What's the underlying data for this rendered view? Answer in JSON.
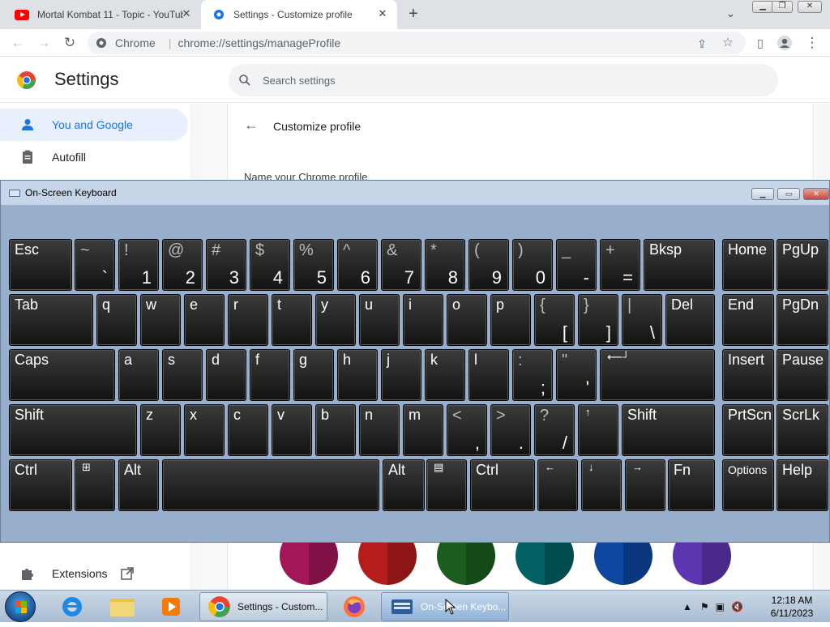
{
  "browser": {
    "tabs": [
      {
        "label": "Mortal Kombat 11 - Topic - YouTube",
        "icon": "youtube-icon"
      },
      {
        "label": "Settings - Customize profile",
        "icon": "settings-gear-icon",
        "active": true
      }
    ],
    "omnibox": {
      "site_chip": "Chrome",
      "url": "chrome://settings/manageProfile"
    }
  },
  "settings": {
    "title": "Settings",
    "search_placeholder": "Search settings",
    "sidebar": [
      {
        "label": "You and Google",
        "icon": "person-icon",
        "active": true
      },
      {
        "label": "Autofill",
        "icon": "clipboard-icon"
      },
      {
        "label": "Extensions",
        "icon": "puzzle-icon"
      }
    ],
    "page_title": "Customize profile",
    "name_label": "Name your Chrome profile",
    "swatch_colors": [
      "#a3165a",
      "#b71c1c",
      "#1b5e20",
      "#006064",
      "#0d47a1",
      "#5e35b1"
    ]
  },
  "osk": {
    "title": "On-Screen Keyboard",
    "rows": [
      [
        {
          "top": "Esc"
        },
        {
          "sym": "~",
          "bot": "`"
        },
        {
          "sym": "!",
          "bot": "1"
        },
        {
          "sym": "@",
          "bot": "2"
        },
        {
          "sym": "#",
          "bot": "3"
        },
        {
          "sym": "$",
          "bot": "4"
        },
        {
          "sym": "%",
          "bot": "5"
        },
        {
          "sym": "^",
          "bot": "6"
        },
        {
          "sym": "&",
          "bot": "7"
        },
        {
          "sym": "*",
          "bot": "8"
        },
        {
          "sym": "(",
          "bot": "9"
        },
        {
          "sym": ")",
          "bot": "0"
        },
        {
          "sym": "_",
          "bot": "-"
        },
        {
          "sym": "+",
          "bot": "="
        },
        {
          "top": "Bksp"
        },
        {
          "top": "Home"
        },
        {
          "top": "PgUp"
        }
      ],
      [
        {
          "top": "Tab"
        },
        {
          "top": "q"
        },
        {
          "top": "w"
        },
        {
          "top": "e"
        },
        {
          "top": "r"
        },
        {
          "top": "t"
        },
        {
          "top": "y"
        },
        {
          "top": "u"
        },
        {
          "top": "i"
        },
        {
          "top": "o"
        },
        {
          "top": "p"
        },
        {
          "sym": "{",
          "bot": "["
        },
        {
          "sym": "}",
          "bot": "]"
        },
        {
          "sym": "|",
          "bot": "\\"
        },
        {
          "top": "Del"
        },
        {
          "top": "End"
        },
        {
          "top": "PgDn"
        }
      ],
      [
        {
          "top": "Caps"
        },
        {
          "top": "a"
        },
        {
          "top": "s"
        },
        {
          "top": "d"
        },
        {
          "top": "f"
        },
        {
          "top": "g"
        },
        {
          "top": "h"
        },
        {
          "top": "j"
        },
        {
          "top": "k"
        },
        {
          "top": "l"
        },
        {
          "sym": ":",
          "bot": ";"
        },
        {
          "sym": "\"",
          "bot": "'"
        },
        {
          "icon": "⟵┘"
        },
        {
          "top": "Insert"
        },
        {
          "top": "Pause"
        }
      ],
      [
        {
          "top": "Shift"
        },
        {
          "top": "z"
        },
        {
          "top": "x"
        },
        {
          "top": "c"
        },
        {
          "top": "v"
        },
        {
          "top": "b"
        },
        {
          "top": "n"
        },
        {
          "top": "m"
        },
        {
          "sym": "<",
          "bot": ","
        },
        {
          "sym": ">",
          "bot": "."
        },
        {
          "sym": "?",
          "bot": "/"
        },
        {
          "icon": "↑"
        },
        {
          "top": "Shift"
        },
        {
          "top": "PrtScn"
        },
        {
          "top": "ScrLk"
        }
      ],
      [
        {
          "top": "Ctrl"
        },
        {
          "icon": "⊞"
        },
        {
          "top": "Alt"
        },
        {
          "top": ""
        },
        {
          "top": "Alt"
        },
        {
          "icon": "▤"
        },
        {
          "top": "Ctrl"
        },
        {
          "icon": "←"
        },
        {
          "icon": "↓"
        },
        {
          "icon": "→"
        },
        {
          "top": "Fn"
        },
        {
          "small": "Options"
        },
        {
          "top": "Help"
        }
      ]
    ]
  },
  "taskbar": {
    "tasks": [
      {
        "label": "Settings - Custom...",
        "icon": "chrome-icon"
      },
      {
        "label": "On-Screen Keybo...",
        "icon": "keyboard-icon",
        "active": true
      }
    ],
    "clock_time": "12:18 AM",
    "clock_date": "6/11/2023"
  }
}
